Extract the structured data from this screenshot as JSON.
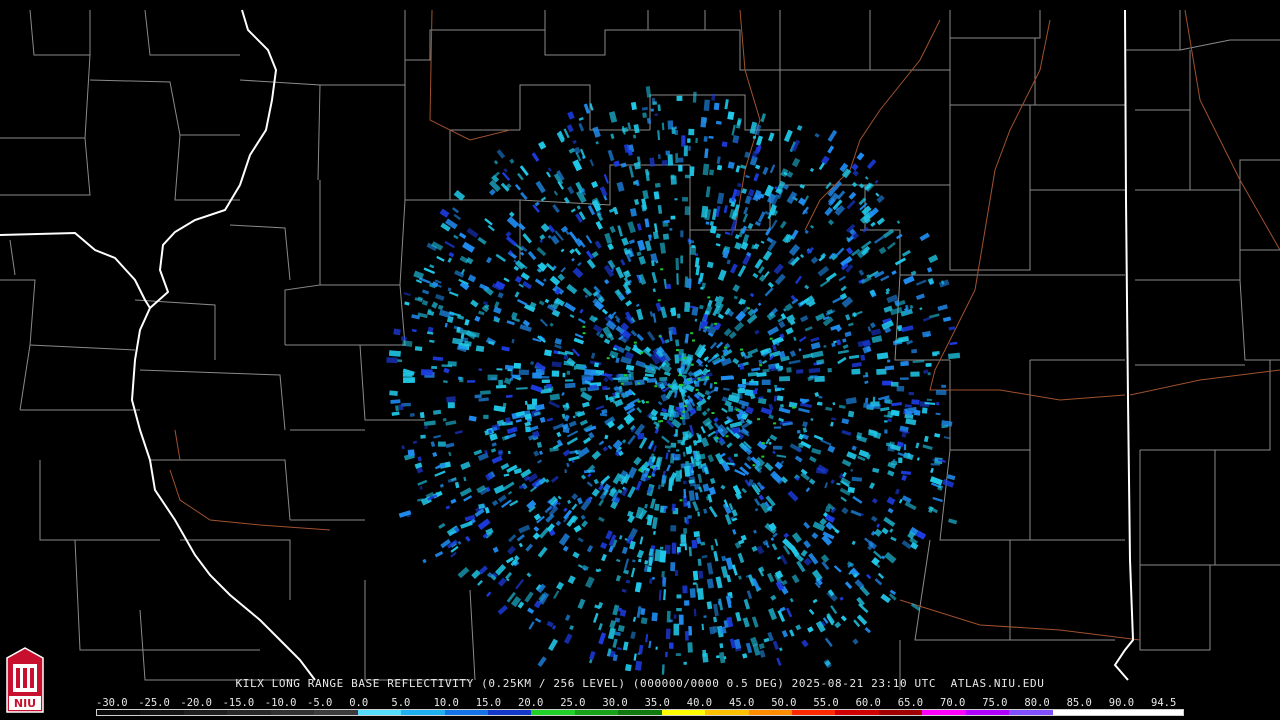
{
  "product_title": "KILX LONG RANGE BASE REFLECTIVITY (0.25KM / 256 LEVEL) (000000/0000 0.5 DEG) 2025-08-21 23:10 UTC  ATLAS.NIU.EDU",
  "logo_text": "NIU",
  "scale_labels": [
    "-30.0",
    "-25.0",
    "-20.0",
    "-15.0",
    "-10.0",
    "-5.0",
    "0.0",
    "5.0",
    "10.0",
    "15.0",
    "20.0",
    "25.0",
    "30.0",
    "35.0",
    "40.0",
    "45.0",
    "50.0",
    "55.0",
    "60.0",
    "65.0",
    "70.0",
    "75.0",
    "80.0",
    "85.0",
    "90.0",
    "94.5"
  ],
  "colors": {
    "background": "#000000",
    "county_lines": "#8a8a8a",
    "state_lines": "#ffffff",
    "river_lines": "#a0522d",
    "echo_light": "#20c8e8",
    "echo_mid": "#1f8cf0",
    "echo_dark": "#1c3ce0",
    "echo_green": "#22c832",
    "logo_red": "#c8102e"
  },
  "colorbar": [
    "#0a0a0a",
    "#141414",
    "#1e1e1e",
    "#282828",
    "#323232",
    "#3c3c3c",
    "#55ddff",
    "#1fb0f0",
    "#1474e6",
    "#1438c8",
    "#22d02a",
    "#18a21a",
    "#107a10",
    "#ffff00",
    "#ffc000",
    "#ff8c00",
    "#ff2a00",
    "#d00000",
    "#a00000",
    "#ff00ff",
    "#b000ff",
    "#8050ff",
    "#ffffff",
    "#ffffff",
    "#ffffff"
  ]
}
